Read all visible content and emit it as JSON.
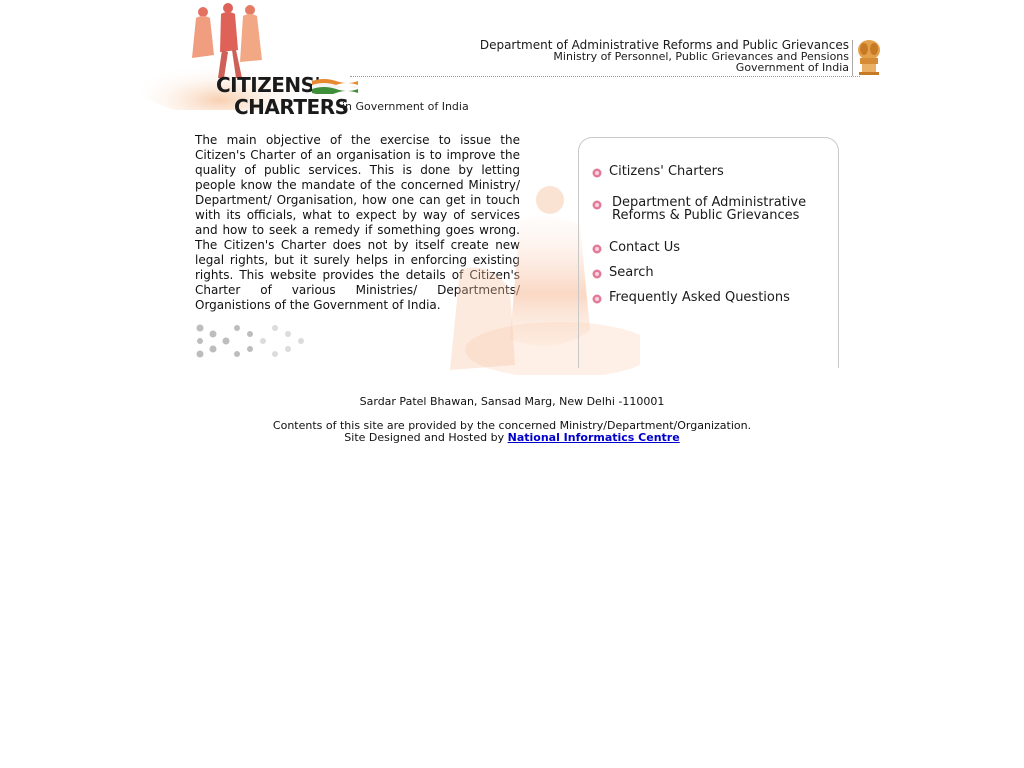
{
  "header": {
    "logo_line1": "CITIZENS'",
    "logo_line2": "CHARTERS",
    "logo_sub": "in Government of India",
    "dept_line1": "Department of Administrative Reforms and Public Grievances",
    "dept_line2": "Ministry of Personnel, Public Grievances and Pensions",
    "dept_line3": "Government of India"
  },
  "intro": {
    "text": "The main objective of the exercise to issue the Citizen's Charter of an organisation is to improve the quality of public services. This is done by letting people know the mandate of the concerned Ministry/ Department/ Organisation, how one can get in touch with its officials, what to expect by way of services and how to seek a remedy if something goes wrong. The Citizen's Charter does not by itself create new legal rights, but it surely helps in enforcing existing rights. This website provides the details of Citizen's Charter of various Ministries/ Departments/ Organistions of the Government of India."
  },
  "menu": {
    "item1": "Citizens' Charters",
    "item2_line1": "Department of Administrative",
    "item2_line2": "Reforms & Public Grievances",
    "item3": "Contact Us",
    "item4": "Search",
    "item5": "Frequently Asked Questions"
  },
  "footer": {
    "address": "Sardar Patel Bhawan, Sansad Marg, New Delhi -110001",
    "contents": "Contents of this site are provided by the concerned Ministry/Department/Organization.",
    "hosted_prefix": "Site Designed and Hosted by",
    "nic_link": "National Informatics Centre"
  },
  "colors": {
    "bullet": "#e27a9a",
    "link": "#0000cc",
    "figure_warm": "#f2a27e",
    "figure_red": "#d9473a"
  },
  "icons": {
    "bullet": "pink-flower-bullet-icon",
    "emblem": "national-emblem-icon",
    "flag": "indian-flag-icon"
  }
}
